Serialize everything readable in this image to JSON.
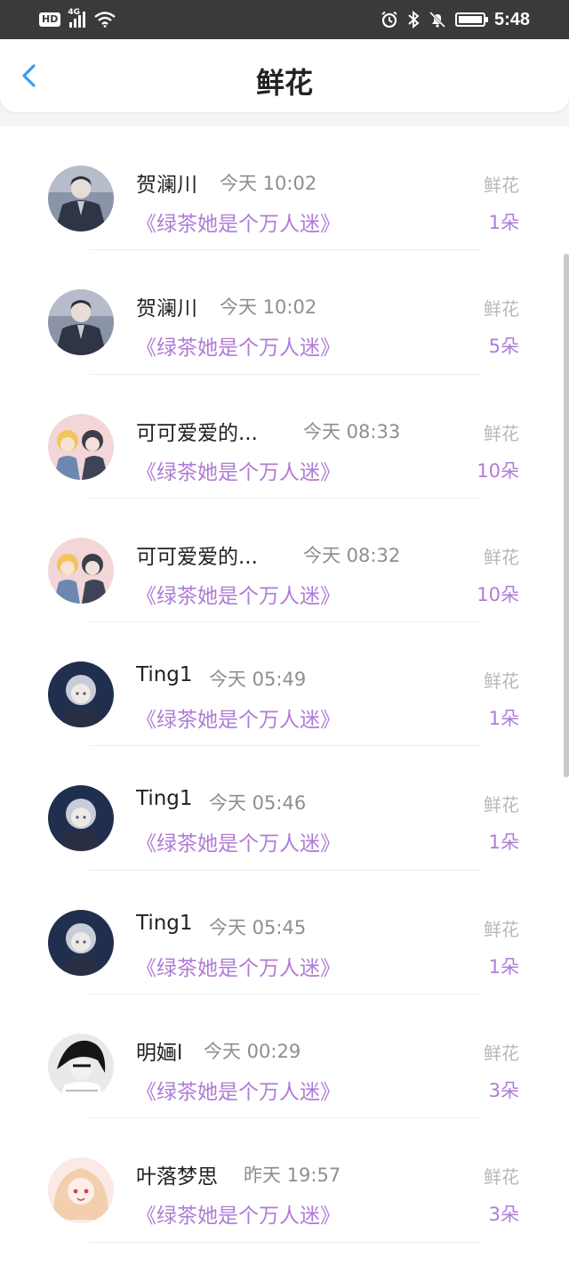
{
  "status_bar": {
    "hd": "HD",
    "network": "4G",
    "time": "5:48",
    "icons": [
      "alarm-icon",
      "bluetooth-icon",
      "mute-icon",
      "battery-charging-icon"
    ]
  },
  "header": {
    "title": "鲜花",
    "back_icon": "chevron-left-icon"
  },
  "colors": {
    "accent_purple": "#b07cd6",
    "back_blue": "#3a9ef0",
    "muted_gray": "#8e8e93"
  },
  "gifts": [
    {
      "name": "贺澜川",
      "time": "今天 10:02",
      "book": "《绿茶她是个万人迷》",
      "type": "鲜花",
      "count": "1朵"
    },
    {
      "name": "贺澜川",
      "time": "今天 10:02",
      "book": "《绿茶她是个万人迷》",
      "type": "鲜花",
      "count": "5朵"
    },
    {
      "name": "可可爱爱的...",
      "time": "今天 08:33",
      "book": "《绿茶她是个万人迷》",
      "type": "鲜花",
      "count": "10朵"
    },
    {
      "name": "可可爱爱的...",
      "time": "今天 08:32",
      "book": "《绿茶她是个万人迷》",
      "type": "鲜花",
      "count": "10朵"
    },
    {
      "name": "Ting1",
      "time": "今天 05:49",
      "book": "《绿茶她是个万人迷》",
      "type": "鲜花",
      "count": "1朵"
    },
    {
      "name": "Ting1",
      "time": "今天 05:46",
      "book": "《绿茶她是个万人迷》",
      "type": "鲜花",
      "count": "1朵"
    },
    {
      "name": "Ting1",
      "time": "今天 05:45",
      "book": "《绿茶她是个万人迷》",
      "type": "鲜花",
      "count": "1朵"
    },
    {
      "name": "明婳l",
      "time": "今天 00:29",
      "book": "《绿茶她是个万人迷》",
      "type": "鲜花",
      "count": "3朵"
    },
    {
      "name": "叶落梦思",
      "time": "昨天 19:57",
      "book": "《绿茶她是个万人迷》",
      "type": "鲜花",
      "count": "3朵"
    }
  ]
}
